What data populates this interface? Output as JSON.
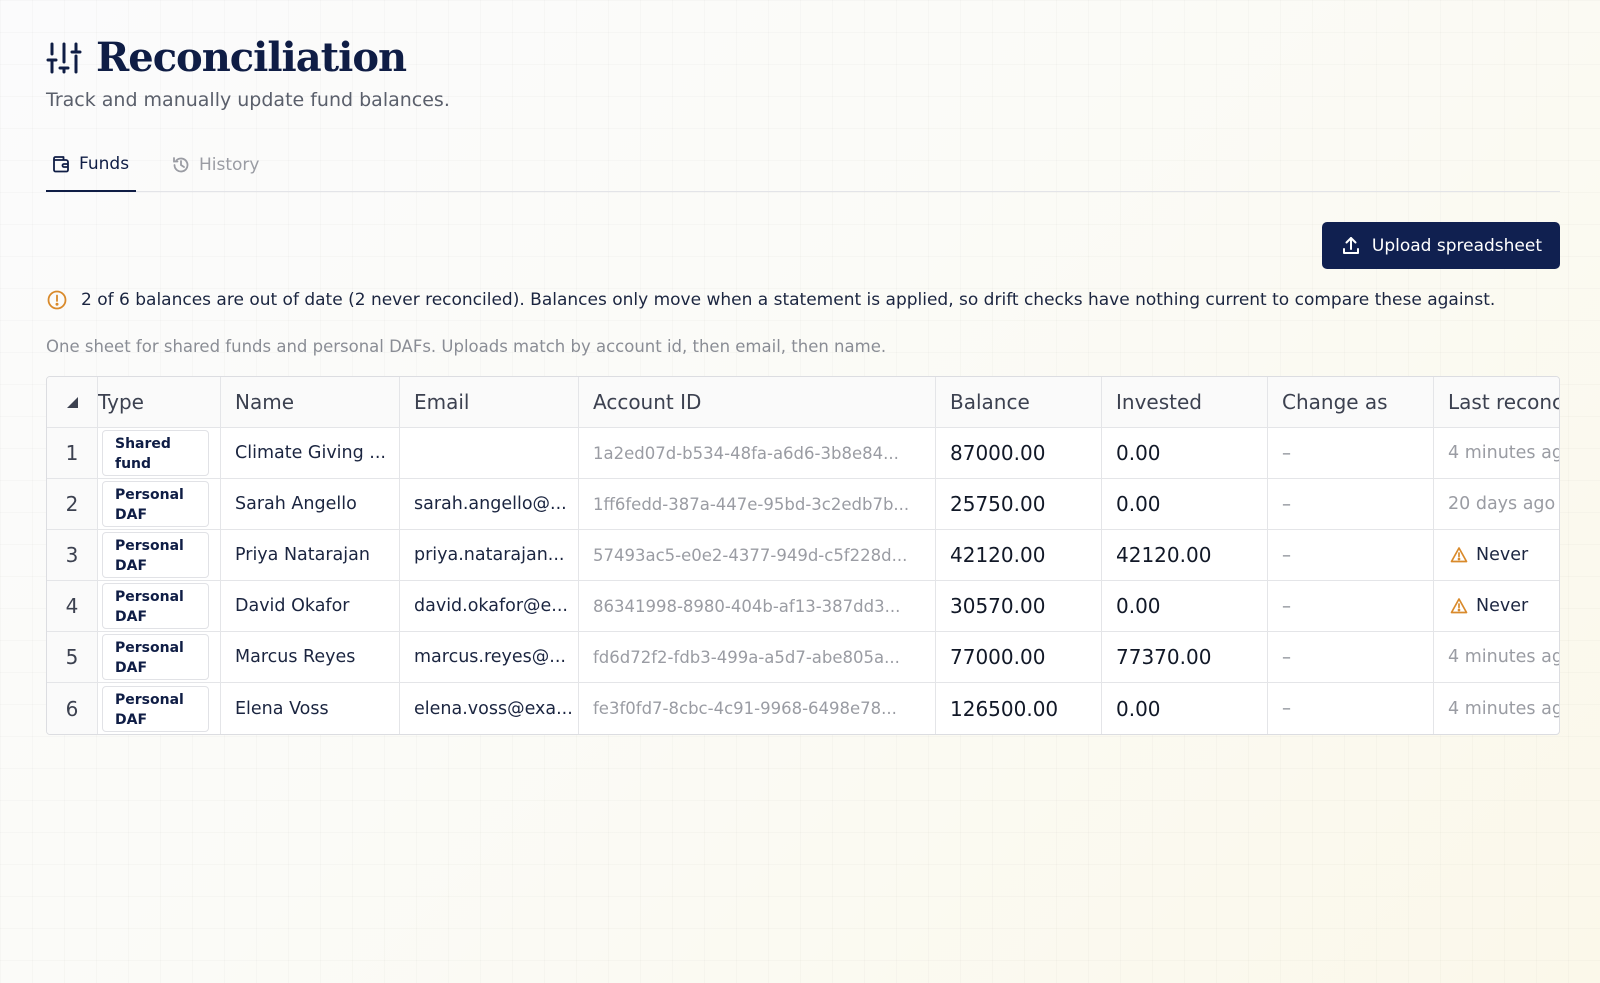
{
  "header": {
    "title": "Reconciliation",
    "subtitle": "Track and manually update fund balances.",
    "title_icon": "sliders-icon"
  },
  "tabs": [
    {
      "label": "Funds",
      "icon": "wallet-icon",
      "active": true
    },
    {
      "label": "History",
      "icon": "history-icon",
      "active": false
    }
  ],
  "actions": {
    "upload_label": "Upload spreadsheet",
    "upload_icon": "upload-icon"
  },
  "alert": {
    "text": "2 of 6 balances are out of date (2 never reconciled). Balances only move when a statement is applied, so drift checks have nothing current to compare these against.",
    "icon": "alert-circle-icon"
  },
  "hint": "One sheet for shared funds and personal DAFs. Uploads match by account id, then email, then name.",
  "table": {
    "columns": [
      "Type",
      "Name",
      "Email",
      "Account ID",
      "Balance",
      "Invested",
      "Change as",
      "Last reconc"
    ],
    "rows": [
      {
        "idx": "1",
        "type": "Shared fund",
        "name": "Climate Giving ...",
        "email": "",
        "account_id": "1a2ed07d-b534-48fa-a6d6-3b8e84...",
        "balance": "87000.00",
        "invested": "0.00",
        "change": "–",
        "last": "4 minutes ag",
        "never": false
      },
      {
        "idx": "2",
        "type": "Personal DAF",
        "name": "Sarah Angello",
        "email": "sarah.angello@...",
        "account_id": "1ff6fedd-387a-447e-95bd-3c2edb7b...",
        "balance": "25750.00",
        "invested": "0.00",
        "change": "–",
        "last": "20 days ago",
        "never": false
      },
      {
        "idx": "3",
        "type": "Personal DAF",
        "name": "Priya Natarajan",
        "email": "priya.natarajan...",
        "account_id": "57493ac5-e0e2-4377-949d-c5f228d...",
        "balance": "42120.00",
        "invested": "42120.00",
        "change": "–",
        "last": "Never",
        "never": true
      },
      {
        "idx": "4",
        "type": "Personal DAF",
        "name": "David Okafor",
        "email": "david.okafor@e...",
        "account_id": "86341998-8980-404b-af13-387dd3...",
        "balance": "30570.00",
        "invested": "0.00",
        "change": "–",
        "last": "Never",
        "never": true
      },
      {
        "idx": "5",
        "type": "Personal DAF",
        "name": "Marcus Reyes",
        "email": "marcus.reyes@...",
        "account_id": "fd6d72f2-fdb3-499a-a5d7-abe805a...",
        "balance": "77000.00",
        "invested": "77370.00",
        "change": "–",
        "last": "4 minutes ag",
        "never": false
      },
      {
        "idx": "6",
        "type": "Personal DAF",
        "name": "Elena Voss",
        "email": "elena.voss@exa...",
        "account_id": "fe3f0fd7-8cbc-4c91-9968-6498e78...",
        "balance": "126500.00",
        "invested": "0.00",
        "change": "–",
        "last": "4 minutes ag",
        "never": false
      }
    ]
  },
  "colors": {
    "primary": "#102050",
    "warning": "#d98a2b",
    "text": "#1b2540",
    "muted": "#9a9ca3"
  }
}
